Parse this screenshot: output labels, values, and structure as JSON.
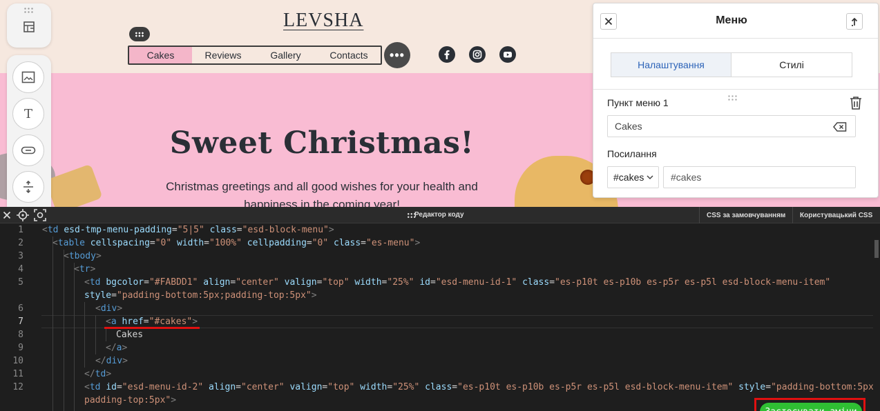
{
  "canvas": {
    "logo": "LEVSHA",
    "menu": [
      "Cakes",
      "Reviews",
      "Gallery",
      "Contacts"
    ],
    "more_label": "•••",
    "hero_title": "Sweet Christmas!",
    "hero_subtitle": "Christmas greetings and all good wishes for your health and happiness in the coming year!",
    "colors": {
      "header_bg": "#f6e8df",
      "hero_bg": "#f9bcd3",
      "menu_active_bg": "#FABDD1"
    },
    "social_icons": [
      "facebook-icon",
      "instagram-icon",
      "youtube-icon"
    ]
  },
  "toolbar": {
    "icons": [
      "layout-icon",
      "image-icon",
      "text-icon",
      "button-icon",
      "spacer-icon"
    ],
    "text_tool_label": "T"
  },
  "panel": {
    "title": "Меню",
    "tabs": [
      "Налаштування",
      "Стилі"
    ],
    "item_label": "Пункт меню 1",
    "item_value": "Cakes",
    "link_label": "Посилання",
    "link_type": "#cakes",
    "link_value": "#cakes"
  },
  "editor": {
    "title": "Редактор коду",
    "tab_css_default": "CSS за замовчуванням",
    "tab_css_custom": "Користувацький CSS",
    "apply_button": "Застосувати зміни",
    "line_numbers": [
      "1",
      "2",
      "3",
      "4",
      "5",
      "",
      "6",
      "7",
      "8",
      "9",
      "10",
      "11",
      "12",
      ""
    ],
    "active_line": "7"
  }
}
